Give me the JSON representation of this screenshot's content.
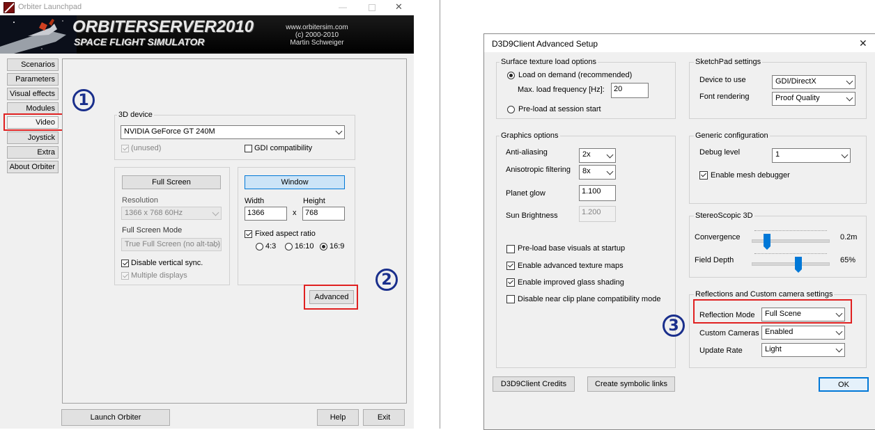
{
  "launchpad": {
    "window_title": "Orbiter Launchpad",
    "banner": {
      "logo_main": "ORBITERSERVER2010",
      "logo_sub": "SPACE FLIGHT SIMULATOR",
      "site": "www.orbitersim.com",
      "copyright": "(c) 2000-2010",
      "author": "Martin Schweiger"
    },
    "nav": [
      "Scenarios",
      "Parameters",
      "Visual effects",
      "Modules",
      "Video",
      "Joystick",
      "Extra",
      "About Orbiter"
    ],
    "device": {
      "group_label": "3D device",
      "selected": "NVIDIA GeForce GT 240M",
      "unused_label": "(unused)",
      "gdi_label": "GDI compatibility"
    },
    "fullscreen": {
      "button": "Full Screen",
      "resolution_label": "Resolution",
      "resolution_value": "1366 x 768 60Hz",
      "mode_label": "Full Screen Mode",
      "mode_value": "True Full Screen (no alt-tab)",
      "vsync_label": "Disable vertical sync.",
      "multi_label": "Multiple displays"
    },
    "window": {
      "button": "Window",
      "width_label": "Width",
      "height_label": "Height",
      "width_value": "1366",
      "x_sep": "x",
      "height_value": "768",
      "fixed_aspect_label": "Fixed aspect ratio",
      "ratio_43": "4:3",
      "ratio_1610": "16:10",
      "ratio_169": "16:9"
    },
    "advanced_button": "Advanced",
    "launch_button": "Launch Orbiter",
    "help_button": "Help",
    "exit_button": "Exit"
  },
  "annotations": {
    "one": "1",
    "two": "2",
    "three": "3"
  },
  "colors": {
    "highlight": "#e02020",
    "annotation": "#1a2f8c",
    "accent": "#0078d7"
  },
  "d3d9": {
    "title": "D3D9Client Advanced Setup",
    "close_glyph": "✕",
    "surface": {
      "group_label": "Surface texture load options",
      "on_demand": "Load on demand (recommended)",
      "max_freq_label": "Max. load frequency [Hz]:",
      "max_freq_value": "20",
      "preload": "Pre-load at session start"
    },
    "sketchpad": {
      "group_label": "SketchPad settings",
      "device_label": "Device to use",
      "device_value": "GDI/DirectX",
      "font_label": "Font rendering",
      "font_value": "Proof Quality"
    },
    "graphics": {
      "group_label": "Graphics options",
      "aa_label": "Anti-aliasing",
      "aa_value": "2x",
      "aniso_label": "Anisotropic filtering",
      "aniso_value": "8x",
      "glow_label": "Planet glow",
      "glow_value": "1.100",
      "sun_label": "Sun Brightness",
      "sun_value": "1.200",
      "cb_preload_base": "Pre-load base visuals at startup",
      "cb_adv_texture": "Enable advanced texture maps",
      "cb_glass": "Enable improved glass shading",
      "cb_nearclip": "Disable near clip plane compatibility mode"
    },
    "generic": {
      "group_label": "Generic configuration",
      "debug_label": "Debug level",
      "debug_value": "1",
      "mesh_debugger": "Enable mesh debugger"
    },
    "stereo": {
      "group_label": "StereoScopic 3D",
      "convergence_label": "Convergence",
      "convergence_value": "0.2m",
      "convergence_level": 0.17,
      "depth_label": "Field Depth",
      "depth_value": "65%",
      "depth_level": 0.61
    },
    "reflections": {
      "group_label": "Reflections and Custom camera settings",
      "mode_label": "Reflection Mode",
      "mode_value": "Full Scene",
      "cameras_label": "Custom Cameras",
      "cameras_value": "Enabled",
      "rate_label": "Update Rate",
      "rate_value": "Light"
    },
    "credits_button": "D3D9Client Credits",
    "symlinks_button": "Create symbolic links",
    "ok_button": "OK"
  }
}
